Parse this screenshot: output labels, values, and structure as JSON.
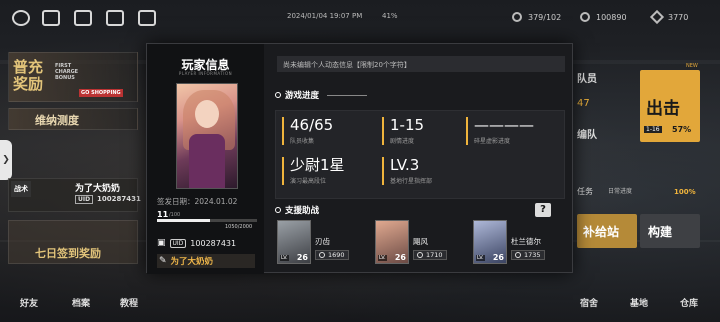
{
  "topbar": {
    "datetime": "2024/01/04 19:07 PM",
    "battery": "41%",
    "resource1": "379/102",
    "resource2": "100890",
    "resource3": "3770"
  },
  "left": {
    "banner_top": "普充奖励",
    "banner_top_sub": "FIRST CHARGE BONUS",
    "banner_shop": "GO SHOPPING",
    "maintenance": "维纳测度",
    "tactics": "战术",
    "player_name": "为了大奶奶",
    "uid_label": "UID",
    "uid": "100287431",
    "checkin": "七日签到奖励"
  },
  "bottom_nav": [
    "好友",
    "档案",
    "教程",
    "宿舍",
    "基地",
    "仓库"
  ],
  "right": {
    "team_label": "队员",
    "team_count": "47",
    "squad_label": "编队",
    "sortie_label": "出击",
    "stage": "1-16",
    "stage_pct": "57%",
    "new_badge": "NEW",
    "task_label": "任务",
    "daily_label": "日常进度",
    "daily_pct": "100%",
    "supply_label": "补给站",
    "build_label": "构建"
  },
  "dialog": {
    "title": "玩家信息",
    "subtitle": "PLAYER INFORMATION",
    "issue_date_label": "签发日期：",
    "issue_date": "2024.01.02",
    "level": "11",
    "level_max": "/100",
    "xp_text": "1050/2000",
    "xp_fraction": 0.525,
    "uid_label": "UID",
    "uid": "100287431",
    "name": "为了大奶奶",
    "bio_placeholder": "尚未编辑个人动态信息【限制20个字符】",
    "progress_title": "游戏进度",
    "stats": [
      {
        "value": "46/65",
        "label": "队员收集"
      },
      {
        "value": "1-15",
        "label": "剧情进度"
      },
      {
        "value": "————",
        "label": "碎星虚影进度"
      },
      {
        "value": "少尉1星",
        "label": "演习最高段位"
      },
      {
        "value": "LV.3",
        "label": "基地行星指挥部"
      }
    ],
    "support_title": "支援助战",
    "help": "?",
    "supports": [
      {
        "name": "刃齿",
        "lv_label": "LV.",
        "level": "26",
        "power": "1690"
      },
      {
        "name": "飓风",
        "lv_label": "LV.",
        "level": "26",
        "power": "1710"
      },
      {
        "name": "杜兰德尔",
        "lv_label": "LV.",
        "level": "26",
        "power": "1735"
      }
    ]
  }
}
